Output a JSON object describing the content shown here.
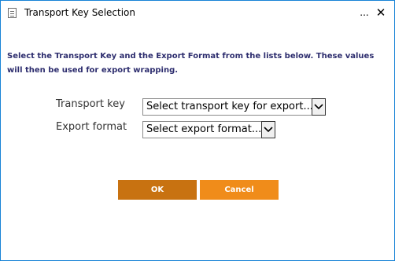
{
  "window": {
    "title": "Transport Key Selection",
    "more_glyph": "...",
    "close_glyph": "✕",
    "icon": "document-icon"
  },
  "instruction": "Select the Transport Key and the Export Format from the lists below. These values will then be used for export wrapping.",
  "form": {
    "transport_key": {
      "label": "Transport key",
      "selected": "Select transport key for export..."
    },
    "export_format": {
      "label": "Export format",
      "selected": "Select export format..."
    }
  },
  "buttons": {
    "ok": "OK",
    "cancel": "Cancel"
  },
  "colors": {
    "ok_button": "#c87211",
    "cancel_button": "#f08c1a",
    "instruction_text": "#2d2d6e",
    "window_border": "#1883d7"
  }
}
